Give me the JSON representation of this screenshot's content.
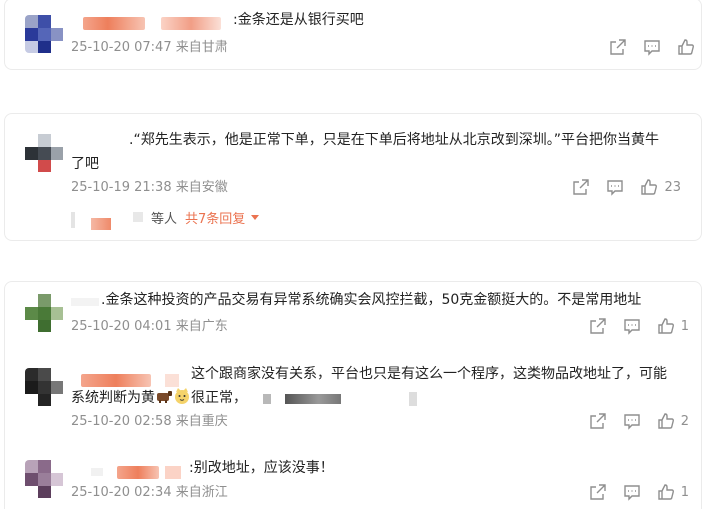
{
  "comments": [
    {
      "text": ":金条还是从银行买吧",
      "meta": "25-10-20 07:47 来自甘肃",
      "likes": ""
    },
    {
      "text_line1": ".“郑先生表示，他是正常下单，只是在下单后将地址从北京改到深圳。”平台把你当黄牛",
      "text_line2": "了吧",
      "meta": "25-10-19 21:38 来自安徽",
      "likes": "23",
      "sub_label": "等人",
      "sub_replies": "共7条回复"
    },
    {
      "text": ".金条这种投资的产品交易有异常系统确实会风控拦截，50克金额挺大的。不是常用地址",
      "meta": "25-10-20 04:01 来自广东",
      "likes": "1"
    },
    {
      "text_line1": "这个跟商家没有关系，平台也只是有这么一个程序，这类物品改地址了，可能",
      "text_line2_a": "系统判断为黄",
      "text_line2_b": "很正常，",
      "meta": "25-10-20 02:58 来自重庆",
      "likes": "2"
    },
    {
      "text": ":别改地址，应该没事！",
      "meta": "25-10-20 02:34 来自浙江",
      "likes": "1"
    }
  ],
  "icons": [
    "share-icon",
    "comment-icon",
    "like-icon"
  ],
  "colors": {
    "accent": "#eb7350",
    "meta": "#8f8f8f",
    "text": "#222222"
  }
}
